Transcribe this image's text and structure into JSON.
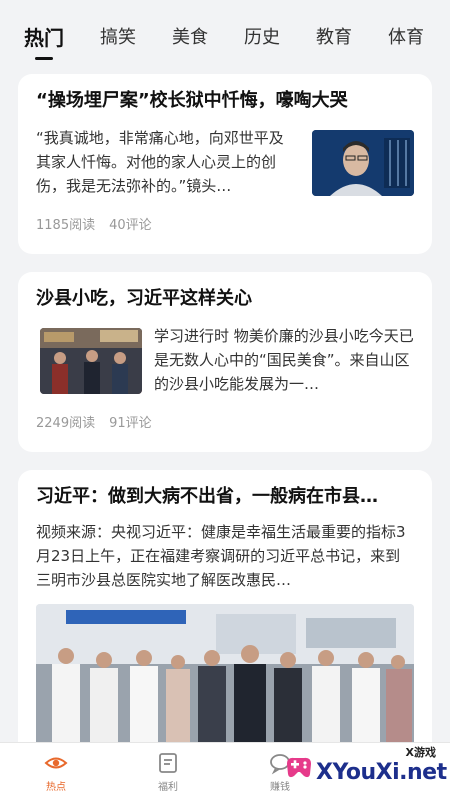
{
  "tabs": [
    {
      "label": "热门"
    },
    {
      "label": "搞笑"
    },
    {
      "label": "美食"
    },
    {
      "label": "历史"
    },
    {
      "label": "教育"
    },
    {
      "label": "体育"
    }
  ],
  "articles": [
    {
      "title": "“操场埋尸案”校长狱中忏悔，嚎啕大哭",
      "snippet": "“我真诚地，非常痛心地，向邓世平及其家人忏悔。对他的家人心灵上的创伤，我是无法弥补的。”镜头…",
      "reads": "1185阅读",
      "comments": "40评论"
    },
    {
      "title": "沙县小吃，习近平这样关心",
      "snippet": "学习进行时 物美价廉的沙县小吃今天已是无数人心中的“国民美食”。来自山区的沙县小吃能发展为一…",
      "reads": "2249阅读",
      "comments": "91评论"
    },
    {
      "title": "习近平：做到大病不出省，一般病在市县…",
      "snippet": "视频来源：央视习近平：健康是幸福生活最重要的指标3月23日上午，正在福建考察调研的习近平总书记，来到三明市沙县总医院实地了解医改惠民…"
    }
  ],
  "bottom_nav": [
    {
      "label": "热点",
      "icon": "eye-icon"
    },
    {
      "label": "福利",
      "icon": "document-icon"
    },
    {
      "label": "赚钱",
      "icon": "chat-icon"
    }
  ],
  "watermark": {
    "small": "X游戏",
    "main": "XYouXi.net"
  },
  "colors": {
    "accent": "#e8692c",
    "background": "#f2f3f5"
  }
}
